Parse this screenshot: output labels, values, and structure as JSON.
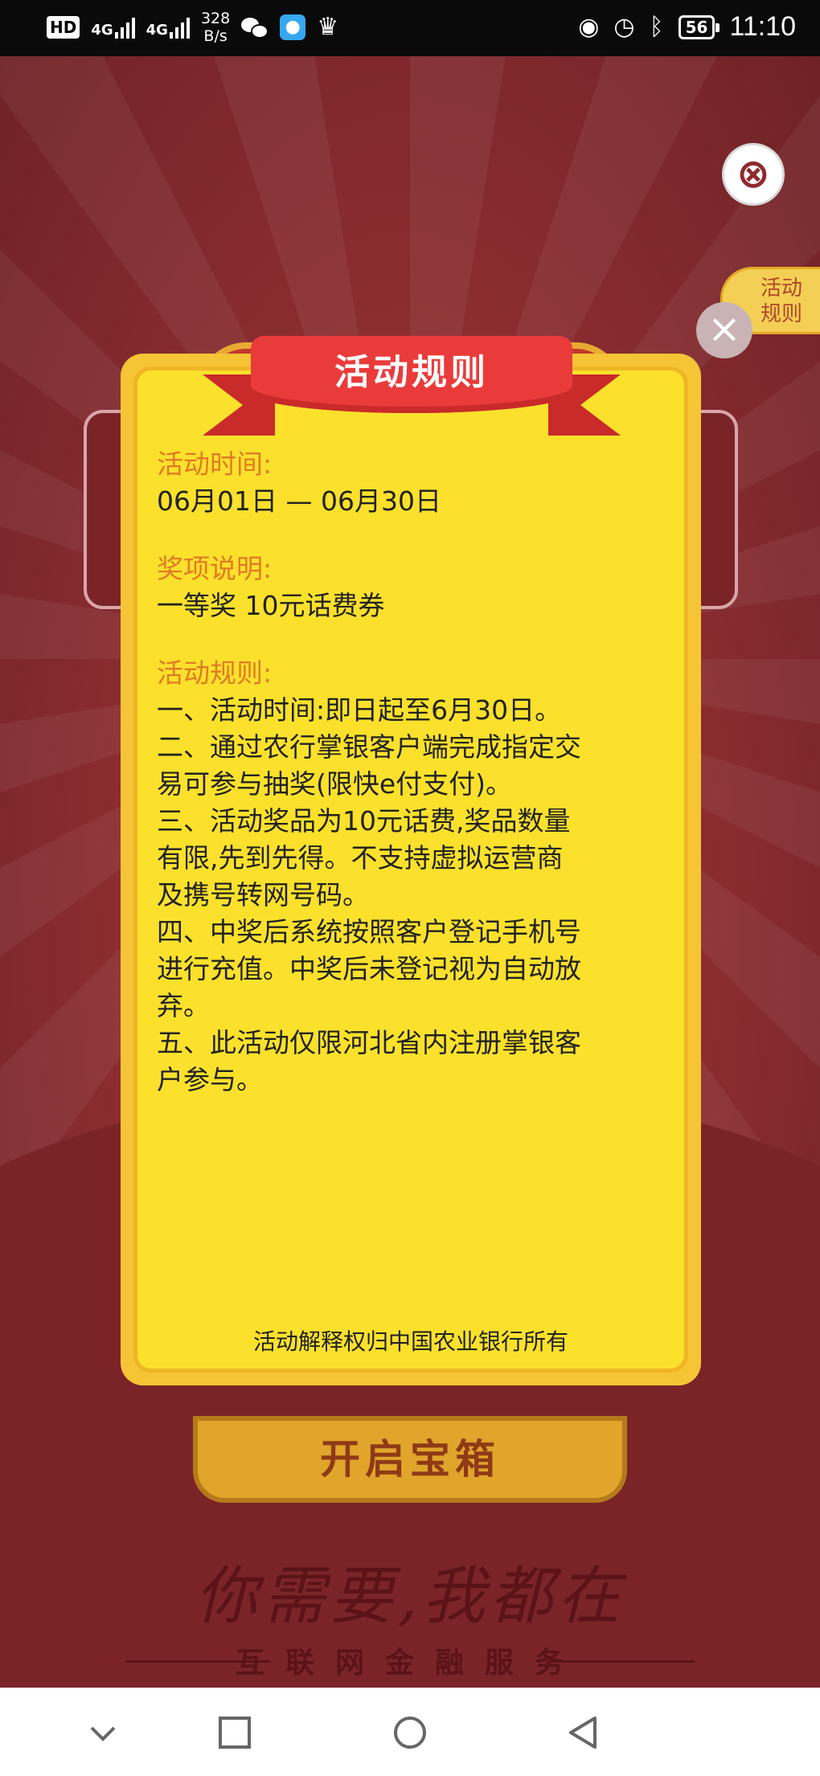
{
  "status_bar": {
    "hd_badge": "HD",
    "network_1": "4G",
    "network_2": "4G",
    "speed_value": "328",
    "speed_unit": "B/s",
    "battery": "56",
    "time": "11:10"
  },
  "background": {
    "rules_tab_line1": "活动",
    "rules_tab_line2": "规则",
    "open_button": "开启宝箱",
    "slogan": "你需要,我都在",
    "sub_slogan": "互联网金融服务"
  },
  "modal": {
    "title": "活动规则",
    "sections": [
      {
        "label": "活动时间:",
        "lines": [
          "06月01日 — 06月30日"
        ]
      },
      {
        "label": "奖项说明:",
        "lines": [
          "一等奖 10元话费券"
        ]
      },
      {
        "label": "活动规则:",
        "lines": [
          "一、活动时间:即日起至6月30日。",
          "二、通过农行掌银客户端完成指定交",
          "易可参与抽奖(限快e付支付)。",
          "三、活动奖品为10元话费,奖品数量",
          "有限,先到先得。不支持虚拟运营商",
          "及携号转网号码。",
          "四、中奖后系统按照客户登记手机号",
          "进行充值。中奖后未登记视为自动放",
          "弃。",
          "五、此活动仅限河北省内注册掌银客",
          "户参与。"
        ]
      }
    ],
    "footer": "活动解释权归中国农业银行所有"
  },
  "colors": {
    "modal_bg": "#fbe12c",
    "label": "#e27a24",
    "ribbon": "#ea3b3b",
    "page_bg": "#8e2e32"
  },
  "icons": {
    "close_top": "close-circle-icon",
    "modal_close": "close-icon",
    "nav_down": "chevron-down-icon",
    "nav_recent": "square-icon",
    "nav_home": "circle-icon",
    "nav_back": "triangle-back-icon"
  }
}
